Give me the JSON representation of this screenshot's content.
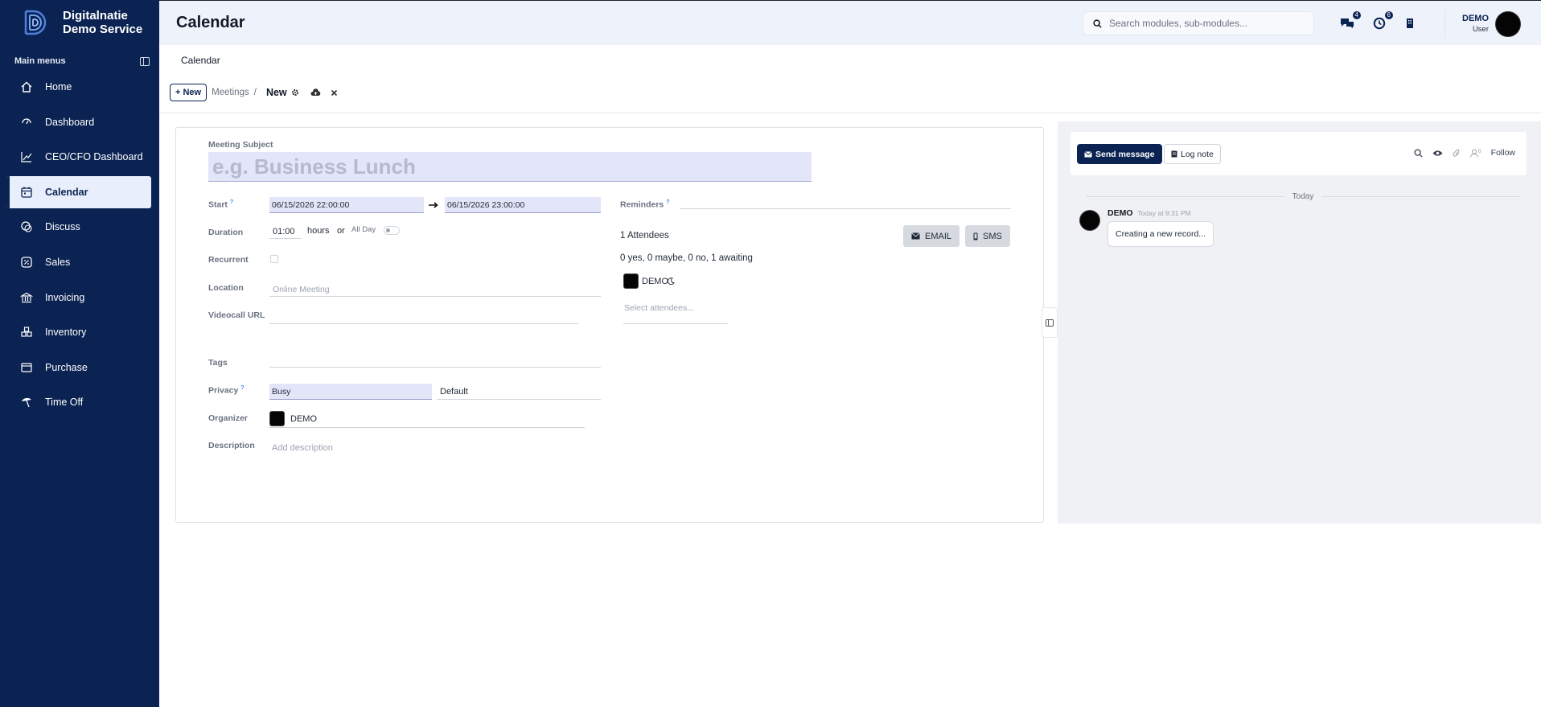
{
  "brand": {
    "line1": "Digitalnatie",
    "line2": "Demo Service"
  },
  "sidebar": {
    "menu_title": "Main menus",
    "items": [
      {
        "label": "Home",
        "icon": "home-icon"
      },
      {
        "label": "Dashboard",
        "icon": "dashboard-icon"
      },
      {
        "label": "CEO/CFO Dashboard",
        "icon": "chart-line-icon"
      },
      {
        "label": "Calendar",
        "icon": "calendar-icon",
        "active": true
      },
      {
        "label": "Discuss",
        "icon": "discuss-icon"
      },
      {
        "label": "Sales",
        "icon": "sales-icon"
      },
      {
        "label": "Invoicing",
        "icon": "invoice-icon"
      },
      {
        "label": "Inventory",
        "icon": "inventory-icon"
      },
      {
        "label": "Purchase",
        "icon": "purchase-icon"
      },
      {
        "label": "Time Off",
        "icon": "timeoff-icon"
      }
    ]
  },
  "header": {
    "title": "Calendar",
    "search_placeholder": "Search modules, sub-modules...",
    "messages_badge": "4",
    "activities_badge": "6",
    "user_name": "DEMO",
    "user_role": "User"
  },
  "control_panel": {
    "top_breadcrumb": "Calendar",
    "new_button": "New",
    "breadcrumb_parent": "Meetings",
    "breadcrumb_sep": "/",
    "breadcrumb_current": "New"
  },
  "form": {
    "subject_label": "Meeting Subject",
    "subject_placeholder": "e.g. Business Lunch",
    "start_label": "Start",
    "start_value": "06/15/2026 22:00:00",
    "end_value": "06/15/2026 23:00:00",
    "duration_label": "Duration",
    "duration_value": "01:00",
    "hours_text": "hours",
    "or_text": "or",
    "allday_label": "All Day",
    "recurrent_label": "Recurrent",
    "location_label": "Location",
    "location_placeholder": "Online Meeting",
    "videocall_label": "Videocall URL",
    "tags_label": "Tags",
    "privacy_label": "Privacy",
    "privacy_value": "Busy",
    "privacy_default": "Default",
    "organizer_label": "Organizer",
    "organizer_value": "DEMO",
    "description_label": "Description",
    "description_placeholder": "Add description",
    "reminders_label": "Reminders",
    "attendees_count": "1 Attendees",
    "email_button": "EMAIL",
    "sms_button": "SMS",
    "attendees_summary": "0 yes, 0 maybe, 0 no, 1 awaiting",
    "attendee_name": "DEMO",
    "select_attendees_placeholder": "Select attendees..."
  },
  "chatter": {
    "send_message": "Send message",
    "log_note": "Log note",
    "attachments_count": "0",
    "follow": "Follow",
    "today": "Today",
    "message_author": "DEMO",
    "message_time": "Today at 9:31 PM",
    "message_body": "Creating a new record..."
  },
  "colors": {
    "navy": "#0b2352",
    "field_bg": "#e3e5f8",
    "chatter_bg": "#f0f1f4"
  }
}
